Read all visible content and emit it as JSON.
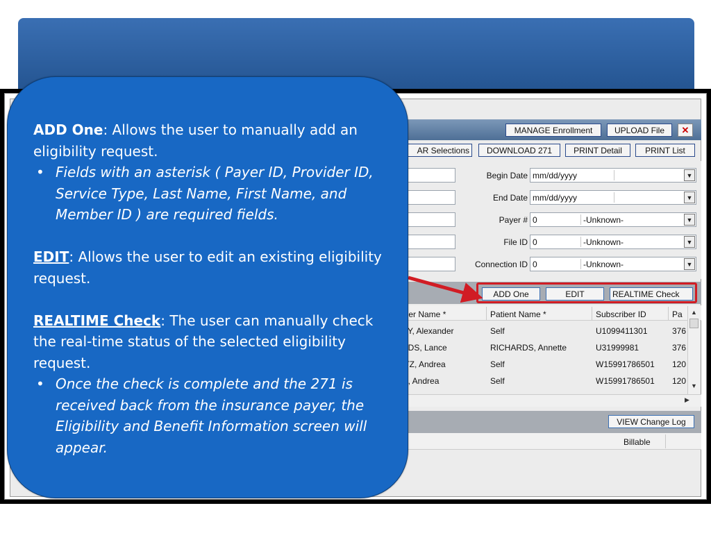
{
  "callout": {
    "add_one_title": "ADD One",
    "add_one_text": ": Allows the user to manually add an eligibility request.",
    "add_one_bullet": "Fields with an asterisk ( Payer ID, Provider ID, Service Type, Last Name, First Name, and Member ID ) are required fields.",
    "edit_title": "EDIT",
    "edit_text": ": Allows the user to edit an existing eligibility request.",
    "realtime_title": "REALTIME Check",
    "realtime_text": ": The user can manually check the real-time status of the selected eligibility request.",
    "realtime_bullet": "Once the check is complete and the 271 is received back from the insurance payer, the Eligibility and Benefit Information screen will appear."
  },
  "toolbar": {
    "manage_enrollment": "MANAGE Enrollment",
    "upload_file": "UPLOAD File",
    "close": "✕",
    "clear_selections": "AR Selections",
    "download_271": "DOWNLOAD 271",
    "print_detail": "PRINT Detail",
    "print_list": "PRINT List"
  },
  "filters": {
    "begin_date_label": "Begin Date",
    "begin_date_value": "mm/dd/yyyy",
    "end_date_label": "End Date",
    "end_date_value": "mm/dd/yyyy",
    "payer_label": "Payer #",
    "payer_value": "0",
    "payer_name": "-Unknown-",
    "file_id_label": "File ID",
    "file_id_value": "0",
    "file_id_name": "-Unknown-",
    "connection_id_label": "Connection ID",
    "connection_id_value": "0",
    "connection_id_name": "-Unknown-"
  },
  "actions": {
    "add_one": "ADD One",
    "edit": "EDIT",
    "realtime_check": "REALTIME Check"
  },
  "grid": {
    "headers": [
      "iber Name *",
      "Patient Name *",
      "Subscriber ID",
      "Pa"
    ],
    "rows": [
      [
        "BY, Alexander",
        "Self",
        "U1099411301",
        "376"
      ],
      [
        "RDS, Lance",
        "RICHARDS, Annette",
        "U31999981",
        "376"
      ],
      [
        "ITZ, Andrea",
        "Self",
        "W15991786501",
        "120"
      ],
      [
        "N, Andrea",
        "Self",
        "W15991786501",
        "120"
      ]
    ]
  },
  "lower": {
    "view_change_log": "VIEW Change Log",
    "billable_header": "Billable"
  },
  "colors": {
    "callout_blue": "#1868c4",
    "highlight_red": "#d11c24",
    "banner_blue": "#2b5c9c"
  }
}
